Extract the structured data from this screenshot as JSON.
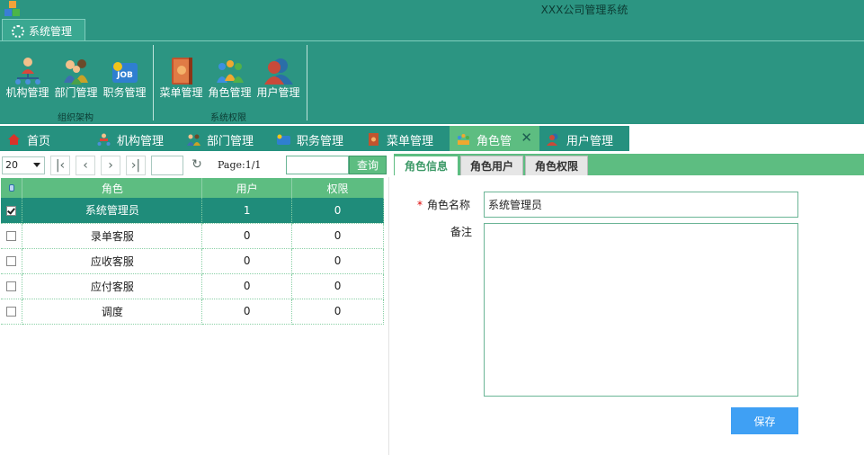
{
  "app": {
    "title": "XXX公司管理系统"
  },
  "ribbon": {
    "tab_label": "系统管理",
    "groups": [
      {
        "label": "组织架构",
        "buttons": [
          "机构管理",
          "部门管理",
          "职务管理"
        ]
      },
      {
        "label": "系统权限",
        "buttons": [
          "菜单管理",
          "角色管理",
          "用户管理"
        ]
      }
    ],
    "job_icon_text": "JOB"
  },
  "tabs": [
    {
      "label": "首页"
    },
    {
      "label": "机构管理"
    },
    {
      "label": "部门管理"
    },
    {
      "label": "职务管理"
    },
    {
      "label": "菜单管理"
    },
    {
      "label": "角色管",
      "active": true
    },
    {
      "label": "用户管理"
    }
  ],
  "pager": {
    "page_size": "20",
    "page_info": "Page:1/1",
    "search_button": "查询"
  },
  "grid": {
    "columns": [
      "角色",
      "用户",
      "权限"
    ],
    "rows": [
      {
        "name": "系统管理员",
        "users": "1",
        "perms": "0",
        "checked": true,
        "selected": true
      },
      {
        "name": "录单客服",
        "users": "0",
        "perms": "0"
      },
      {
        "name": "应收客服",
        "users": "0",
        "perms": "0"
      },
      {
        "name": "应付客服",
        "users": "0",
        "perms": "0"
      },
      {
        "name": "调度",
        "users": "0",
        "perms": "0"
      }
    ]
  },
  "detail": {
    "subtabs": [
      "角色信息",
      "角色用户",
      "角色权限"
    ],
    "required_mark": "*",
    "name_label": "角色名称",
    "name_value": "系统管理员",
    "remark_label": "备注",
    "remark_value": "",
    "save_button": "保存"
  },
  "colors": {
    "header_teal": "#2c9582",
    "accent_green": "#5dbd81",
    "selected_row": "#1f8c7a",
    "save_blue": "#3fa0f4"
  }
}
